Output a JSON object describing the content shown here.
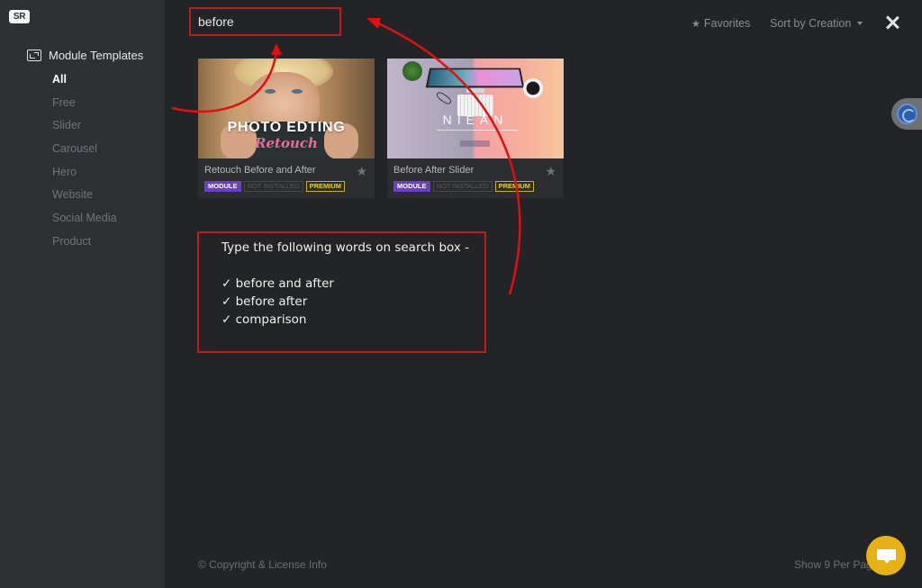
{
  "app": {
    "logo_text": "SR"
  },
  "sidebar": {
    "category_title": "Module Templates",
    "category_icon": "template-icon",
    "filters": [
      {
        "label": "All",
        "active": true
      },
      {
        "label": "Free"
      },
      {
        "label": "Slider"
      },
      {
        "label": "Carousel"
      },
      {
        "label": "Hero"
      },
      {
        "label": "Website"
      },
      {
        "label": "Social Media"
      },
      {
        "label": "Product"
      }
    ]
  },
  "toolbar": {
    "search_value": "before",
    "favorites_label": "Favorites",
    "favorites_icon": "star-icon",
    "sort_label": "Sort by Creation",
    "close_icon": "close-icon"
  },
  "cards": [
    {
      "title": "Retouch Before and After",
      "thumb_headline": "PHOTO EDTING",
      "thumb_script": "Retouch",
      "badges": {
        "type": "MODULE",
        "status": "NOT INSTALLED",
        "tier": "PREMIUM"
      }
    },
    {
      "title": "Before After Slider",
      "thumb_headline": "NIEAN",
      "badges": {
        "type": "MODULE",
        "status": "NOT INSTALLED",
        "tier": "PREMIUM"
      }
    }
  ],
  "annotation": {
    "heading": "Type the following words on search box -",
    "items": [
      "✓ before and after",
      "✓ before after",
      "✓ comparison"
    ],
    "color": "#c01c1c"
  },
  "footer": {
    "copyright": "© Copyright & License Info",
    "per_page": "Show 9 Per Page"
  },
  "colors": {
    "accent_module": "#6a3fc7",
    "accent_premium": "#e6d21e",
    "chat_button": "#e6b215",
    "annotation_red": "#c01c1c"
  }
}
